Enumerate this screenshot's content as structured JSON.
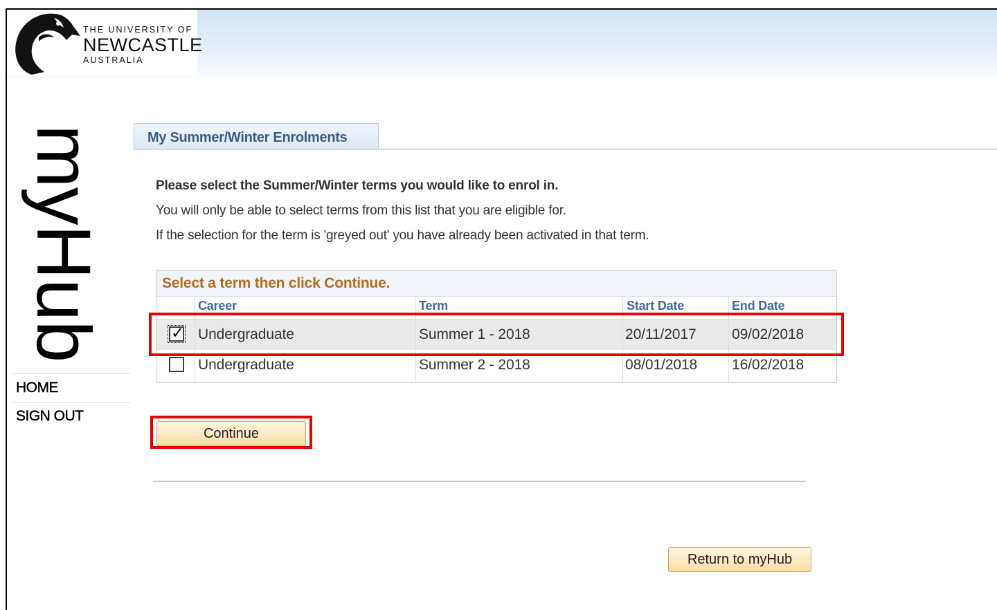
{
  "header": {
    "logo": {
      "line1": "THE UNIVERSITY OF",
      "line2": "NEWCASTLE",
      "line3": "AUSTRALIA",
      "icon": "seahorse-logo-icon"
    }
  },
  "sidebar": {
    "title": "myHub",
    "items": [
      {
        "label": "HOME"
      },
      {
        "label": "SIGN OUT"
      }
    ]
  },
  "tab": {
    "label": "My Summer/Winter Enrolments"
  },
  "instructions": {
    "line1": "Please select the Summer/Winter terms you would like to enrol in.",
    "line2": "You will only be able to select terms from this list that you are eligible for.",
    "line3": "If the selection for the term is 'greyed out' you have already been activated in that term."
  },
  "grid": {
    "title": "Select a term then click Continue.",
    "columns": [
      "Career",
      "Term",
      "Start Date",
      "End Date"
    ],
    "rows": [
      {
        "checked": true,
        "career": "Undergraduate",
        "term": "Summer 1 - 2018",
        "start": "20/11/2017",
        "end": "09/02/2018"
      },
      {
        "checked": false,
        "career": "Undergraduate",
        "term": "Summer 2 - 2018",
        "start": "08/01/2018",
        "end": "16/02/2018"
      }
    ]
  },
  "buttons": {
    "continue": "Continue",
    "return": "Return to myHub"
  },
  "colors": {
    "highlight": "#e60000",
    "grid_title": "#b46b21",
    "column_header": "#3d6d9c",
    "button_fill": "#fbdca3"
  }
}
